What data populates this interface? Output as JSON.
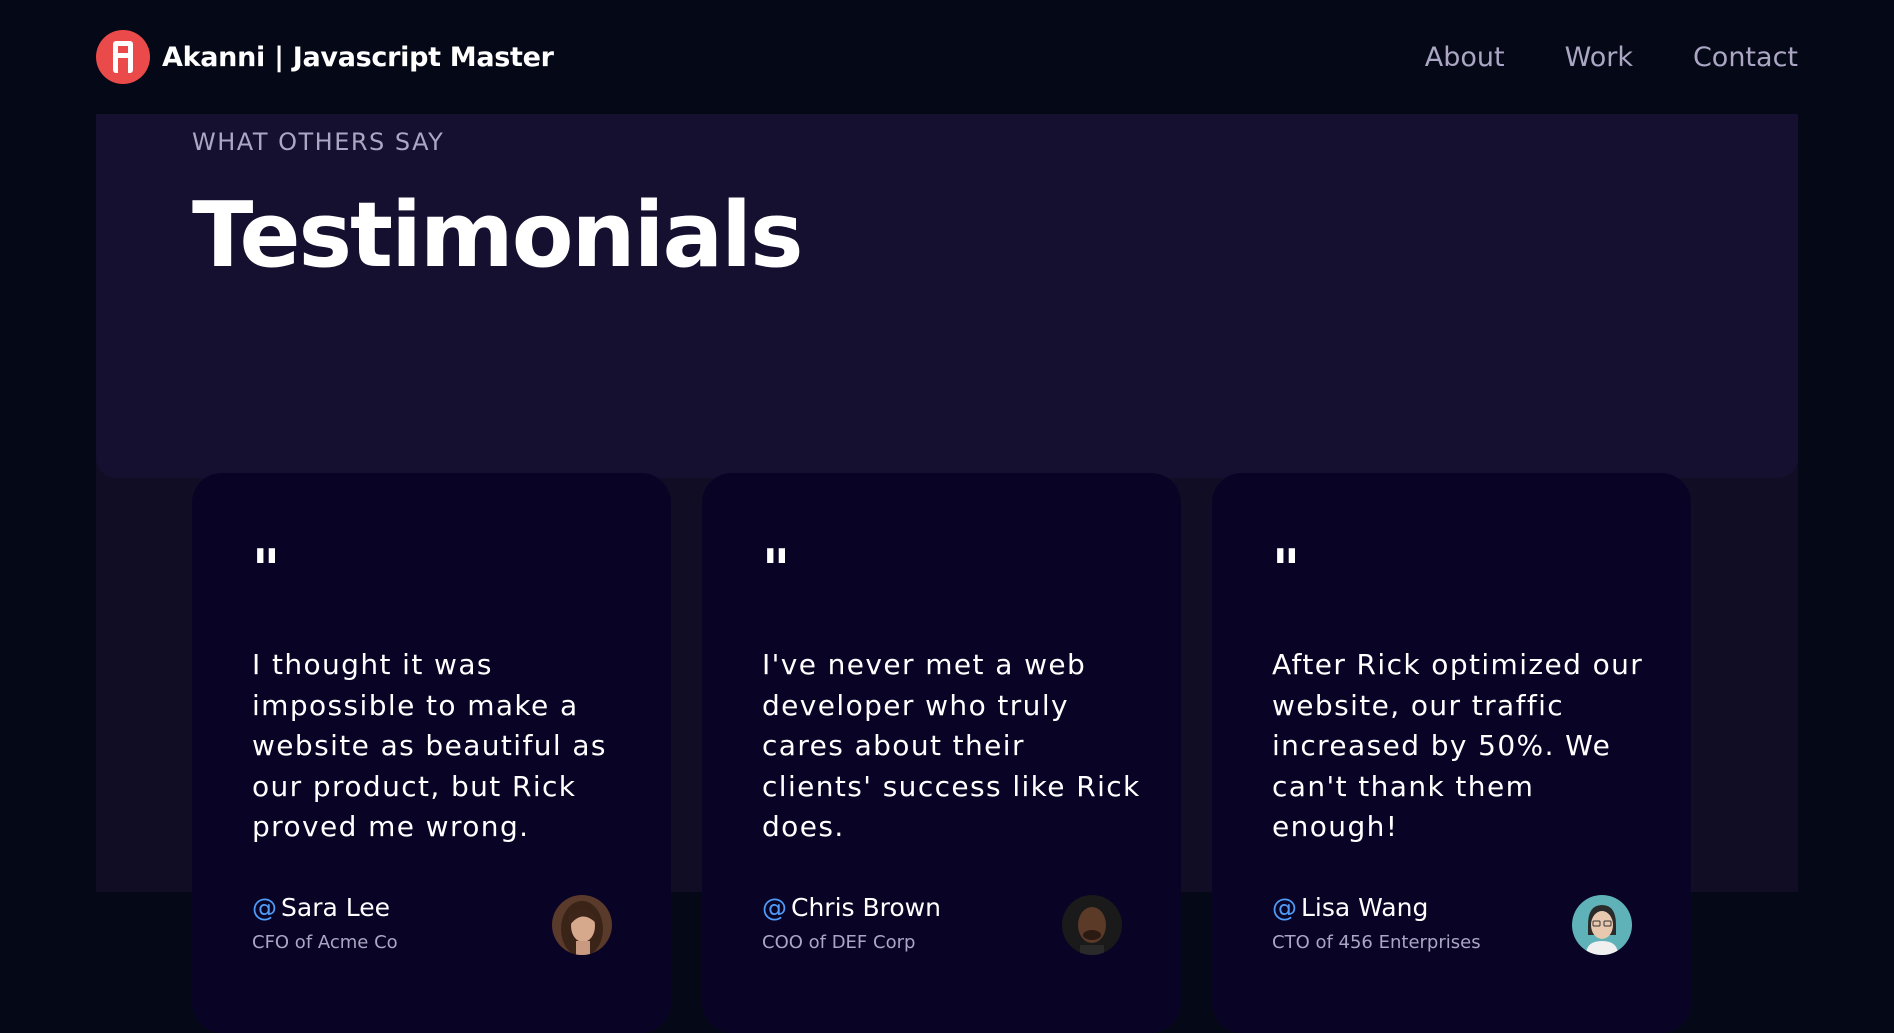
{
  "header": {
    "brand": "Akanni | Javascript Master",
    "nav": [
      "About",
      "Work",
      "Contact"
    ]
  },
  "section": {
    "subtitle": "WHAT OTHERS SAY",
    "title": "Testimonials"
  },
  "testimonials": [
    {
      "quote_mark": "\"",
      "quote": "I thought it was impossible to make a website as beautiful as our product, but Rick proved me wrong.",
      "at": "@",
      "name": "Sara Lee",
      "role": "CFO of Acme Co"
    },
    {
      "quote_mark": "\"",
      "quote": "I've never met a web developer who truly cares about their clients' success like Rick does.",
      "at": "@",
      "name": "Chris Brown",
      "role": "COO of DEF Corp"
    },
    {
      "quote_mark": "\"",
      "quote": "After Rick optimized our website, our traffic increased by 50%. We can't thank them enough!",
      "at": "@",
      "name": "Lisa Wang",
      "role": "CTO of 456 Enterprises"
    }
  ],
  "colors": {
    "background": "#050816",
    "section": "#100d25",
    "section_head": "#151030",
    "card": "#090325",
    "secondary_text": "#aaa6c3",
    "accent_blue": "#4f9cf9",
    "logo_red": "#ea4a4a"
  },
  "icons": [
    "logo-icon",
    "avatar-sara-lee",
    "avatar-chris-brown",
    "avatar-lisa-wang"
  ]
}
